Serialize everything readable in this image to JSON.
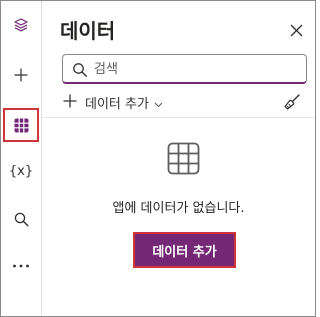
{
  "theme": {
    "accent": "#742774",
    "highlight_border": "#d13438"
  },
  "rail": {
    "items": [
      {
        "name": "layers-icon"
      },
      {
        "name": "plus-icon"
      },
      {
        "name": "data-grid-icon",
        "selected": true
      },
      {
        "name": "variables-icon",
        "glyph": "{x}"
      },
      {
        "name": "search-icon"
      },
      {
        "name": "more-icon"
      }
    ]
  },
  "panel": {
    "title": "데이터",
    "search": {
      "placeholder": "검색",
      "value": ""
    },
    "add_data_label": "데이터 추가",
    "empty_message": "앱에 데이터가 없습니다.",
    "add_data_button_label": "데이터 추가"
  }
}
